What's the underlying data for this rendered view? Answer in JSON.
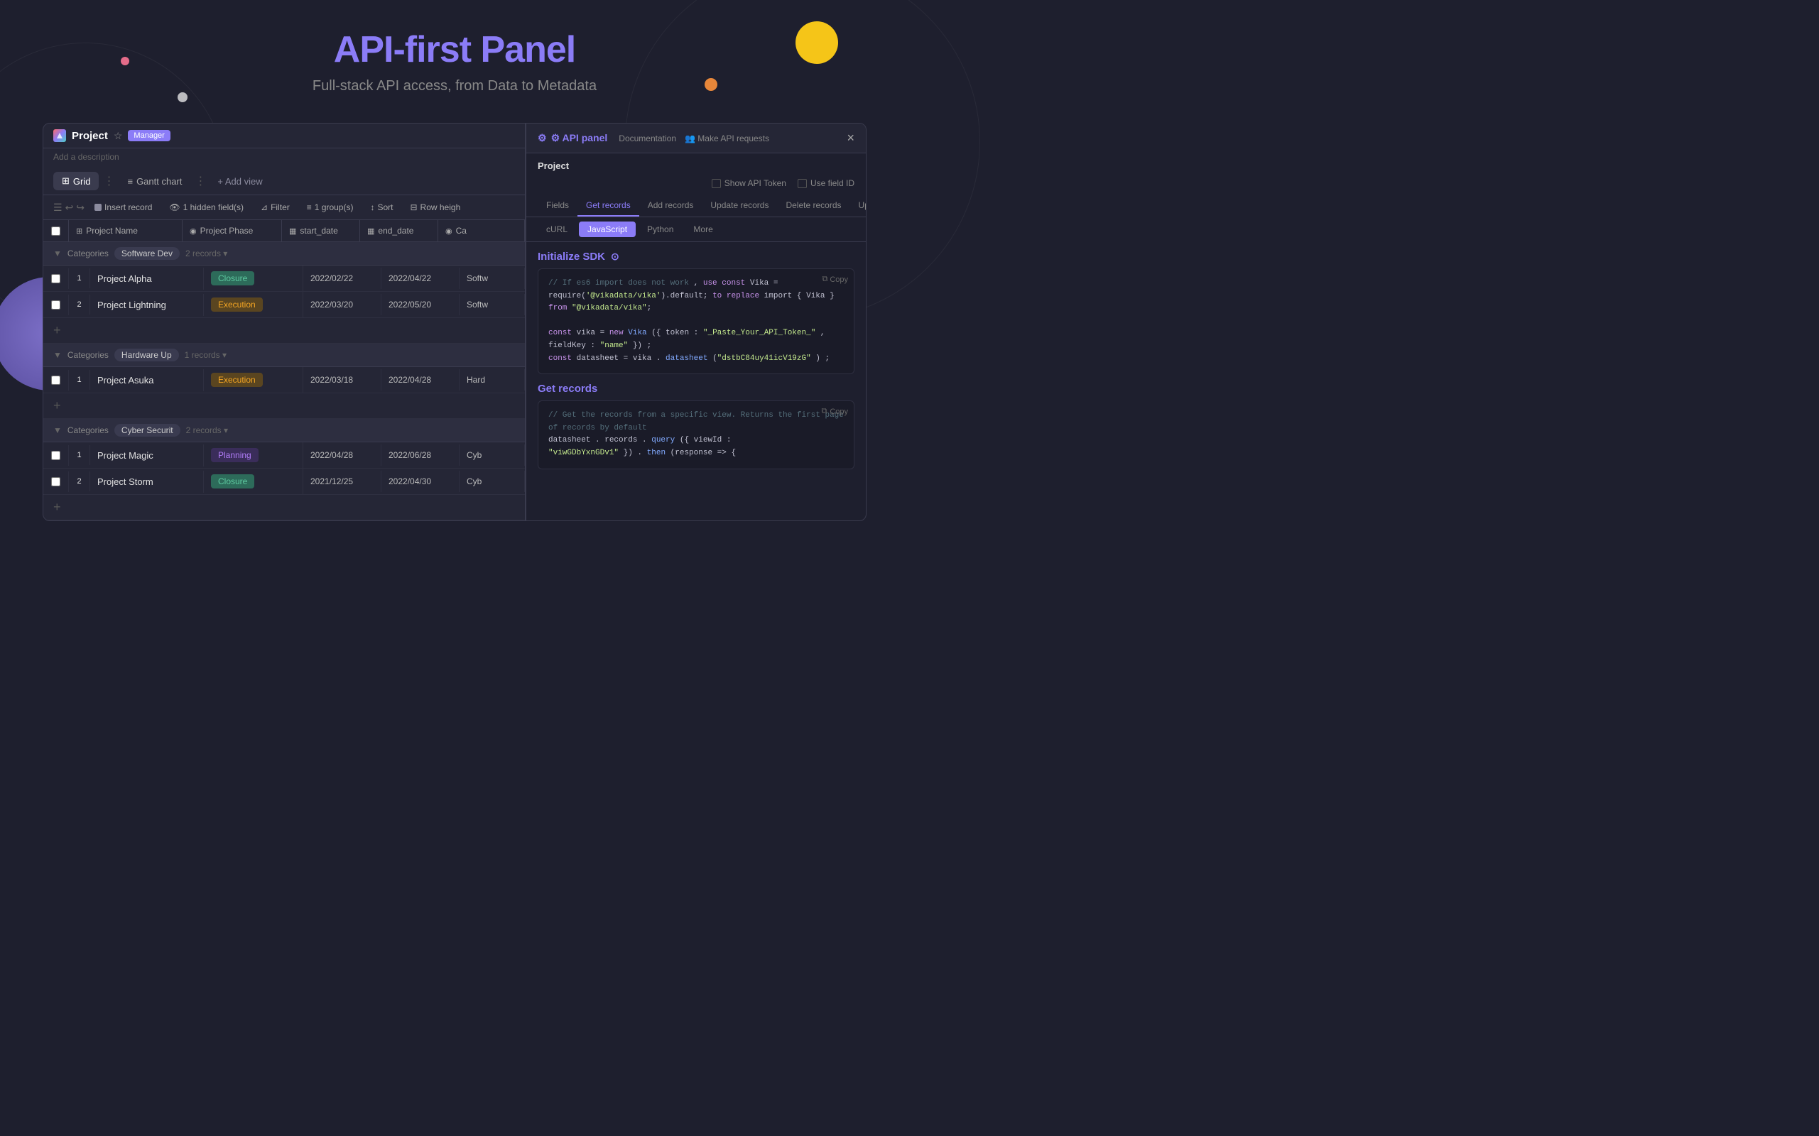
{
  "header": {
    "title_plain": "API-first",
    "title_accent": "Panel",
    "subtitle": "Full-stack API access, from Data to Metadata"
  },
  "project": {
    "name": "Project",
    "star": "☆",
    "role": "Manager",
    "description": "Add a description"
  },
  "view_tabs": {
    "grid": "Grid",
    "gantt": "Gantt chart",
    "add_view": "+ Add view"
  },
  "actions": {
    "insert_record": "Insert record",
    "hidden_fields": "1 hidden field(s)",
    "filter": "Filter",
    "group": "1 group(s)",
    "sort": "Sort",
    "row_height": "Row heigh"
  },
  "columns": [
    {
      "icon": "⊞",
      "label": "Project Name"
    },
    {
      "icon": "◉",
      "label": "Project Phase"
    },
    {
      "icon": "▦",
      "label": "start_date"
    },
    {
      "icon": "▦",
      "label": "end_date"
    },
    {
      "icon": "◉",
      "label": "Ca"
    }
  ],
  "groups": [
    {
      "label": "Categories",
      "tag": "Software Dev",
      "count": "2 records",
      "rows": [
        {
          "num": "1",
          "name": "Project Alpha",
          "phase": "Closure",
          "phase_type": "closure",
          "start": "2022/02/22",
          "end": "2022/04/22",
          "cat": "Softw"
        },
        {
          "num": "2",
          "name": "Project Lightning",
          "phase": "Execution",
          "phase_type": "execution",
          "start": "2022/03/20",
          "end": "2022/05/20",
          "cat": "Softw"
        }
      ]
    },
    {
      "label": "Categories",
      "tag": "Hardware Up",
      "count": "1 records",
      "rows": [
        {
          "num": "1",
          "name": "Project Asuka",
          "phase": "Execution",
          "phase_type": "execution",
          "start": "2022/03/18",
          "end": "2022/04/28",
          "cat": "Hard"
        }
      ]
    },
    {
      "label": "Categories",
      "tag": "Cyber Securit",
      "count": "2 records",
      "rows": [
        {
          "num": "1",
          "name": "Project Magic",
          "phase": "Planning",
          "phase_type": "planning",
          "start": "2022/04/28",
          "end": "2022/06/28",
          "cat": "Cyb"
        },
        {
          "num": "2",
          "name": "Project Storm",
          "phase": "Closure",
          "phase_type": "closure",
          "start": "2021/12/25",
          "end": "2022/04/30",
          "cat": "Cyb"
        }
      ]
    }
  ],
  "api_panel": {
    "title": "⚙ API panel",
    "doc_link": "Documentation",
    "make_api": "Make API requests",
    "project_label": "Project",
    "show_api_token": "Show API Token",
    "use_field_id": "Use field ID",
    "close": "×",
    "tabs": [
      "Fields",
      "Get records",
      "Add records",
      "Update records",
      "Delete records",
      "Upload attachmen"
    ],
    "subtabs": [
      "cURL",
      "JavaScript",
      "Python",
      "More"
    ],
    "active_tab": "Get records",
    "active_subtab": "JavaScript",
    "initialize_sdk_title": "Initialize SDK",
    "get_records_title": "Get records",
    "copy_label": "Copy",
    "code_init": "// If es6 import does not work          , use const Vika =\nrequire('@vikadata/vika').default; to replace import { Vika }\nfrom \"@vikadata/vika\";\n\nconst vika   = new Vika ({ token :  \"_Paste_Your_API_Token_\"   ,\n  fieldKey  :  \"name\" }) ;\nconst datasheet   = vika . datasheet (\"dstbC84uy41icV19zG\"   ) ;",
    "code_get_records": "// Get the records from a specific view. Returns the first page\nof records by default\ndatasheet . records . query ({ viewId  :\n  \"viwGDbYxnGDv1\" }) . then (response  => {"
  }
}
